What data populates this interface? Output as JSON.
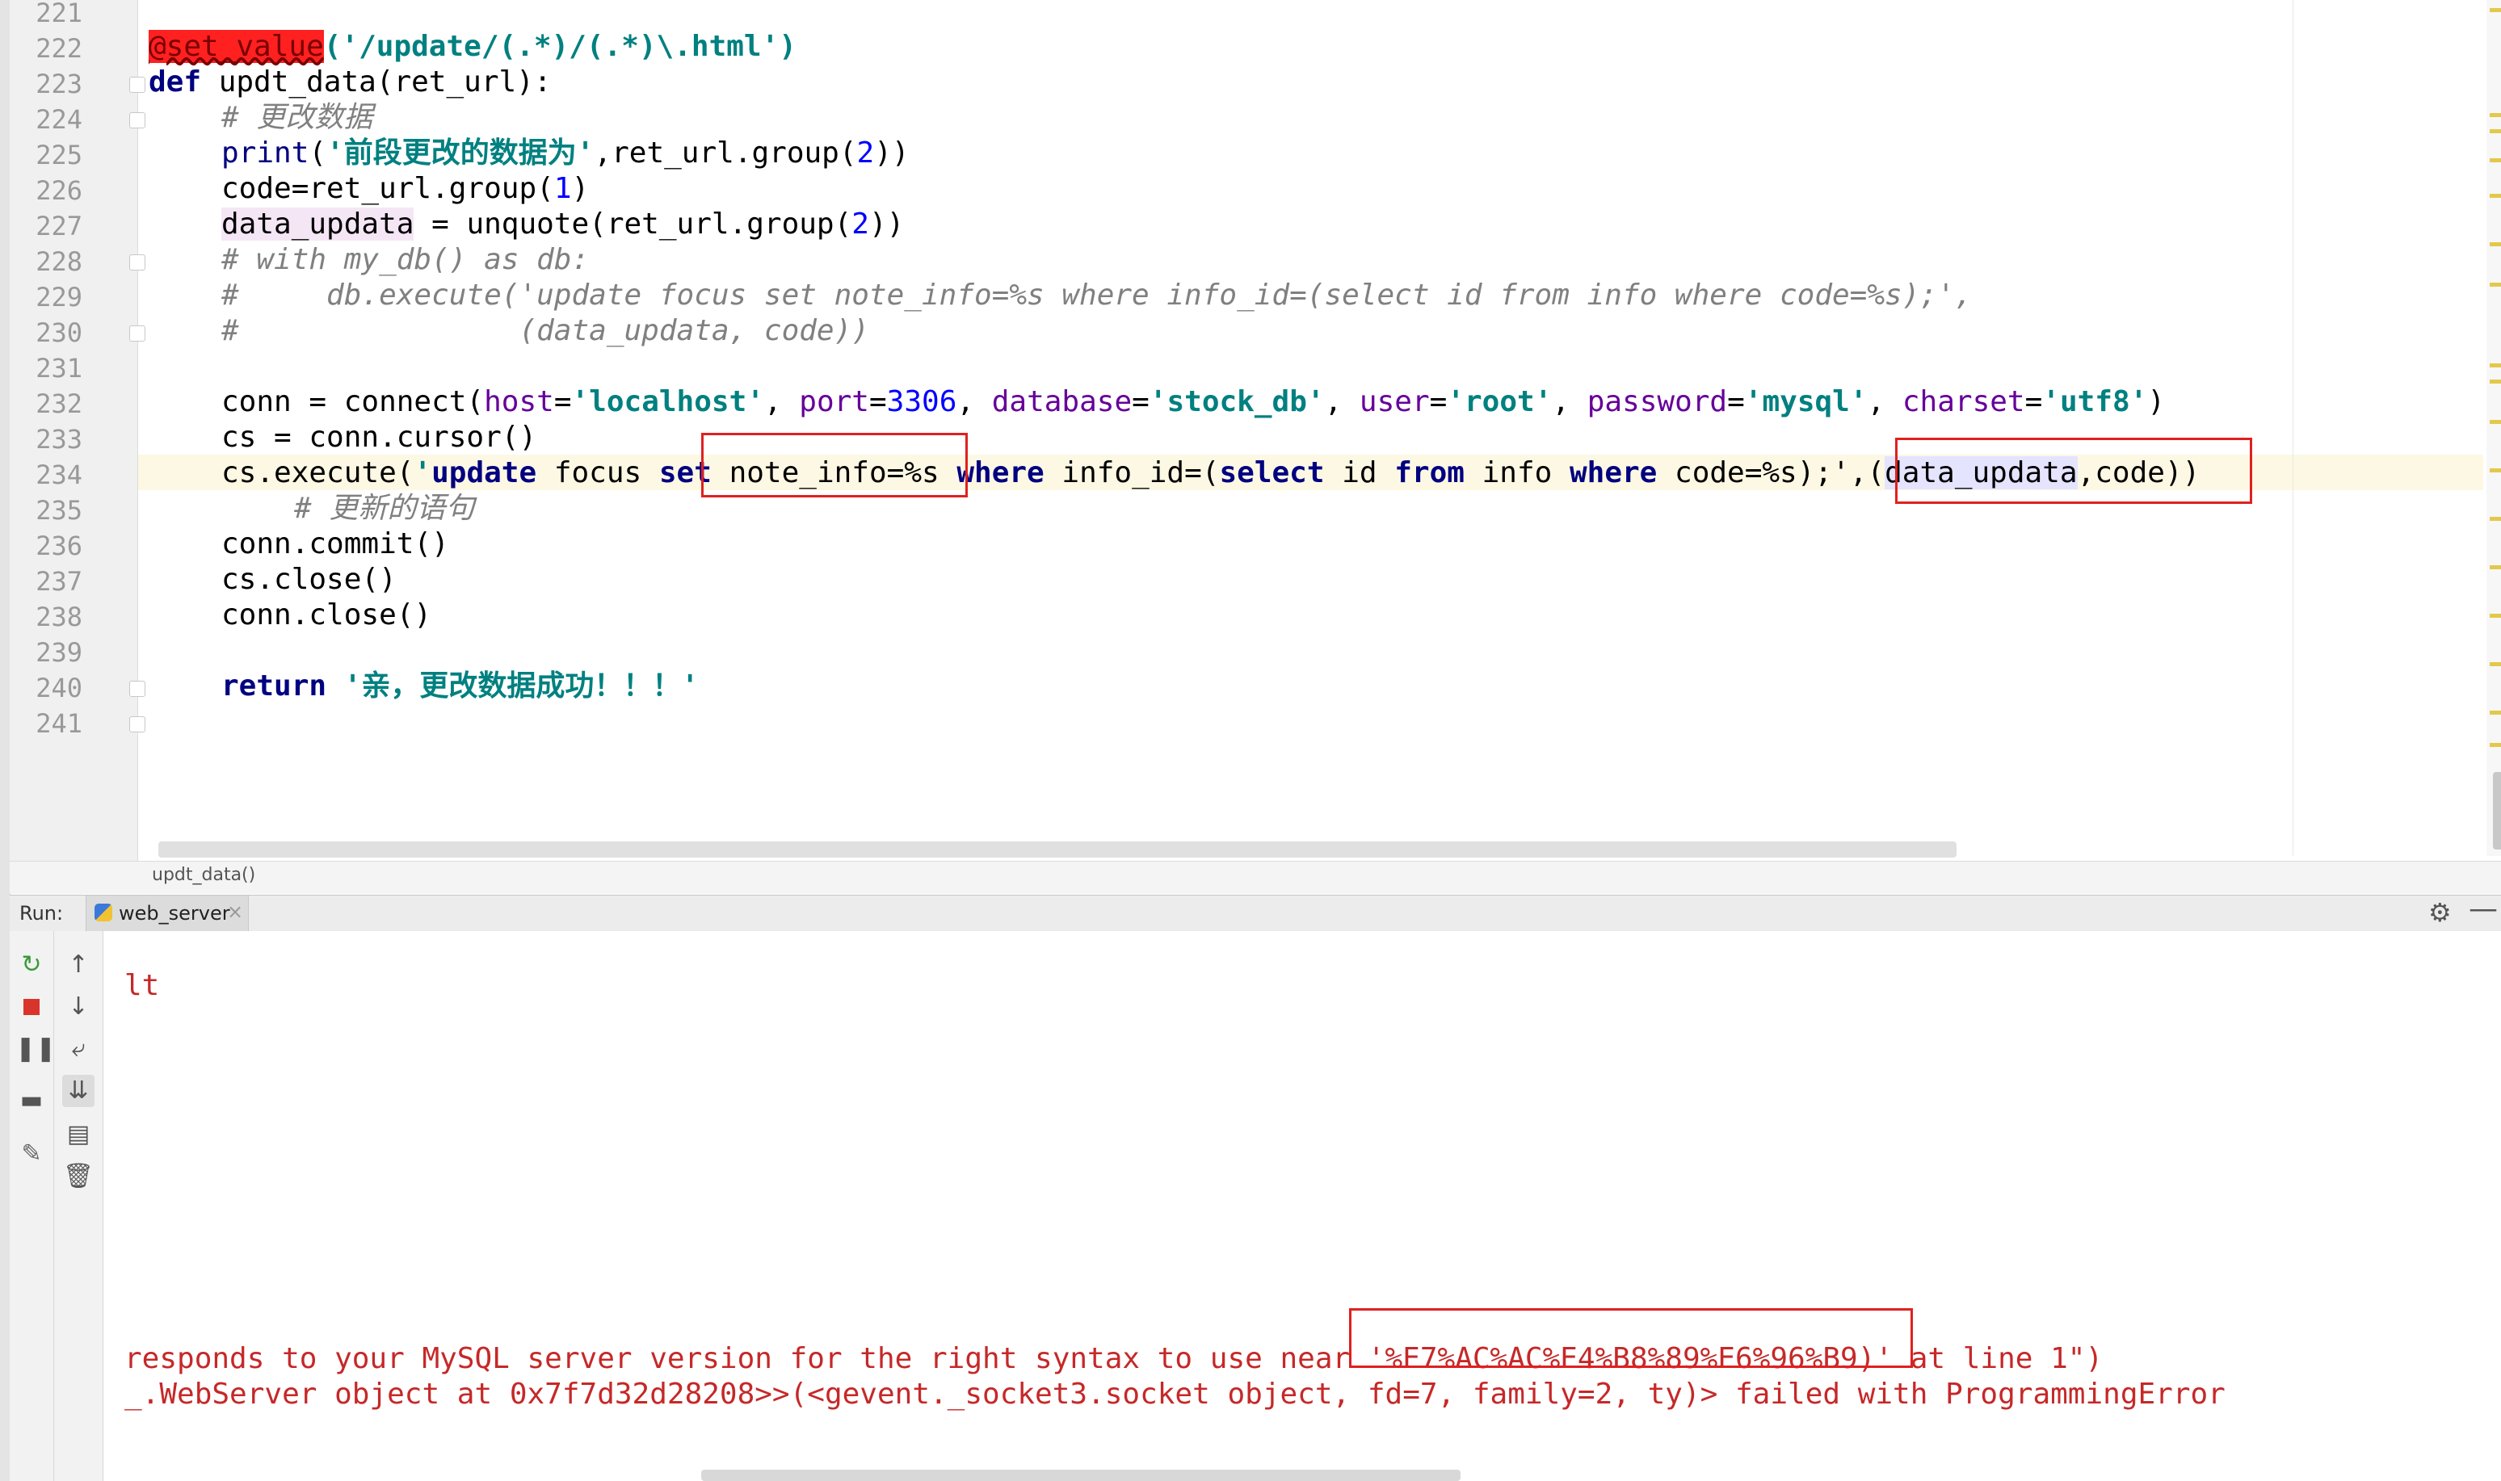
{
  "editor": {
    "lines": [
      {
        "n": "221",
        "text": ""
      },
      {
        "n": "222",
        "decorator": "@set_value",
        "args": "('/update/(.*)/(.*)\\.html')"
      },
      {
        "n": "223",
        "kw": "def",
        "text": " updt_data(ret_url):"
      },
      {
        "n": "224",
        "comment": "# 更改数据"
      },
      {
        "n": "225",
        "fn": "print",
        "s1": "(",
        "str": "'前段更改的数据为'",
        "s2": ",ret_url.group(",
        "num": "2",
        "s3": "))"
      },
      {
        "n": "226",
        "t1": "code=ret_url.group(",
        "num": "1",
        "t2": ")"
      },
      {
        "n": "227",
        "var": "data_updata",
        "t1": " = unquote(ret_url.group(",
        "num": "2",
        "t2": "))"
      },
      {
        "n": "228",
        "comment": "# with my_db() as db:"
      },
      {
        "n": "229",
        "comment": "#     db.execute('update focus set note_info=%s where info_id=(select id from info where code=%s);',"
      },
      {
        "n": "230",
        "comment": "#                (data_updata, code))"
      },
      {
        "n": "231",
        "text": ""
      },
      {
        "n": "232",
        "text": "conn = connect(host='localhost', port=3306, database='stock_db', user='root', password='mysql', charset='utf8')"
      },
      {
        "n": "233",
        "text": "cs = conn.cursor()"
      },
      {
        "n": "234",
        "text": "cs.execute('update focus set note_info=%s where info_id=(select id from info where code=%s);',(data_updata,code))"
      },
      {
        "n": "235",
        "comment": "# 更新的语句"
      },
      {
        "n": "236",
        "text": "conn.commit()"
      },
      {
        "n": "237",
        "text": "cs.close()"
      },
      {
        "n": "238",
        "text": "conn.close()"
      },
      {
        "n": "239",
        "text": ""
      },
      {
        "n": "240",
        "kw": "return",
        "str": "'亲，更改数据成功！！！'"
      },
      {
        "n": "241",
        "text": ""
      }
    ],
    "l232": {
      "a": "conn = connect(",
      "p1": "host",
      "e1": "=",
      "v1": "'localhost'",
      "c1": ", ",
      "p2": "port",
      "e2": "=",
      "v2": "3306",
      "c2": ", ",
      "p3": "database",
      "e3": "=",
      "v3": "'stock_db'",
      "c3": ", ",
      "p4": "user",
      "e4": "=",
      "v4": "'root'",
      "c4": ", ",
      "p5": "password",
      "e5": "=",
      "v5": "'mysql'",
      "c5": ", ",
      "p6": "charset",
      "e6": "=",
      "v6": "'utf8'",
      "z": ")"
    },
    "l234": {
      "a": "cs.execute(",
      "q": "'",
      "k1": "update",
      "t1": " focus ",
      "k2": "set",
      "t2": " note_info=%s ",
      "k3": "where",
      "t3": " info_id=(",
      "k4": "select",
      "t4": " id ",
      "k5": "from",
      "t5": " info ",
      "k6": "where",
      "t6": " code=%s);'",
      "t7": ",(",
      "var": "data_updata",
      "t8": ",code))"
    }
  },
  "breadcrumb": "updt_data()",
  "run_panel": {
    "label": "Run:",
    "tab": "web_server",
    "tab_close": "×",
    "gear": "⚙",
    "minimize": "—"
  },
  "console": {
    "lines": [
      "lt",
      "responds to your MySQL server version for the right syntax to use near '%E7%AC%AC%E4%B8%89%E6%96%B9)' at line 1\")",
      "_.WebServer object at 0x7f7d32d28208>>(<gevent._socket3.socket object, fd=7, family=2, ty)> failed with ProgrammingError"
    ]
  },
  "colors": {
    "keyword": "#000080",
    "string": "#008080",
    "number": "#0000ff",
    "param": "#660099",
    "comment": "#808080",
    "error": "#c62828",
    "annotation_box": "#e02020"
  }
}
